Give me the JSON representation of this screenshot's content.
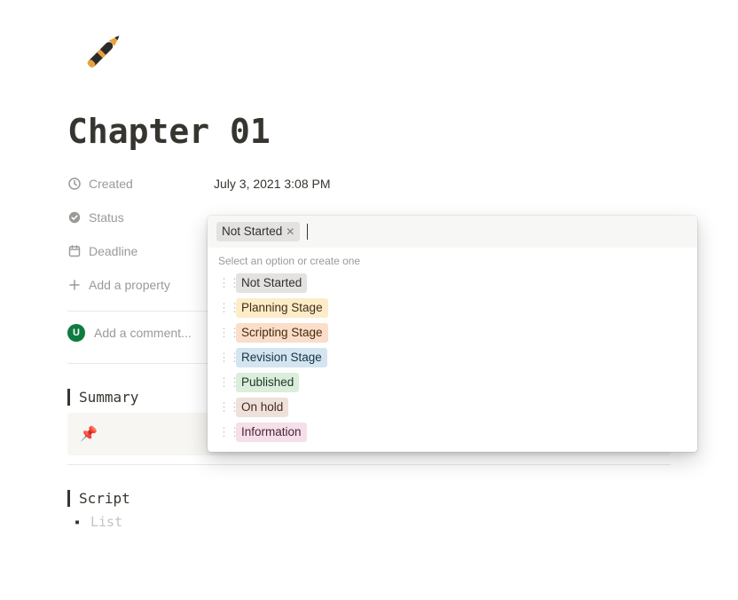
{
  "page": {
    "title": "Chapter 01"
  },
  "properties": {
    "created": {
      "label": "Created",
      "value": "July 3, 2021 3:08 PM"
    },
    "status": {
      "label": "Status"
    },
    "deadline": {
      "label": "Deadline"
    },
    "add": {
      "label": "Add a property"
    }
  },
  "comment": {
    "avatar_initial": "U",
    "placeholder": "Add a comment..."
  },
  "sections": {
    "summary": {
      "heading": "Summary"
    },
    "script": {
      "heading": "Script",
      "bullet_placeholder": "List"
    }
  },
  "status_popover": {
    "selected": {
      "label": "Not Started",
      "color": "gray"
    },
    "hint": "Select an option or create one",
    "options": [
      {
        "label": "Not Started",
        "color": "gray"
      },
      {
        "label": "Planning Stage",
        "color": "yellow"
      },
      {
        "label": "Scripting Stage",
        "color": "orange"
      },
      {
        "label": "Revision Stage",
        "color": "blue"
      },
      {
        "label": "Published",
        "color": "green"
      },
      {
        "label": "On hold",
        "color": "brown"
      },
      {
        "label": "Information",
        "color": "pink"
      }
    ]
  }
}
